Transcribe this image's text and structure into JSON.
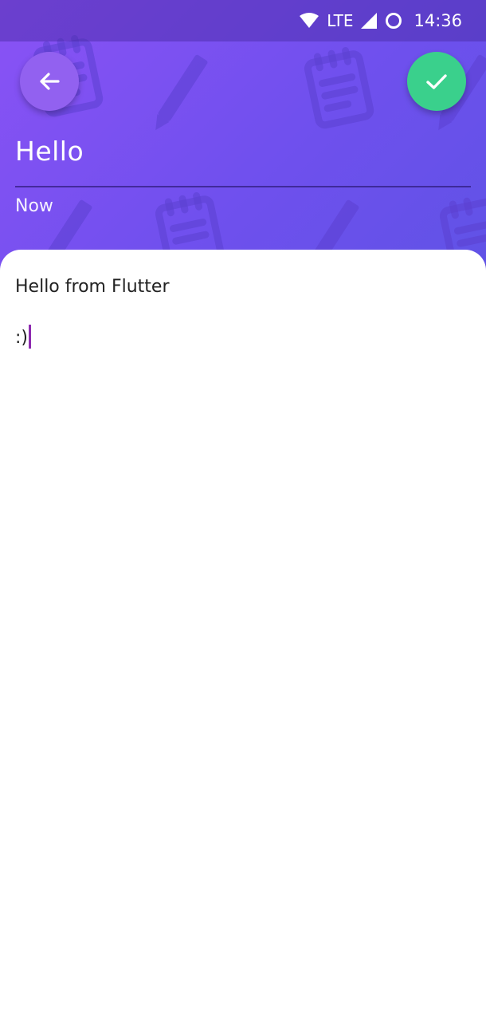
{
  "status_bar": {
    "network": "LTE",
    "time": "14:36",
    "icons": [
      "wifi-icon",
      "cell-signal-icon",
      "circle-icon"
    ]
  },
  "toolbar": {
    "back_icon": "arrow-back-icon",
    "save_icon": "check-icon"
  },
  "note": {
    "title": "Hello",
    "date": "Now",
    "body_lines": [
      "Hello from Flutter",
      ":)"
    ]
  },
  "colors": {
    "header_gradient_start": "#8a52f5",
    "header_gradient_end": "#6052e6",
    "save_button": "#3ad08c",
    "back_button": "#9261f0",
    "caret": "#8e2bb0"
  }
}
